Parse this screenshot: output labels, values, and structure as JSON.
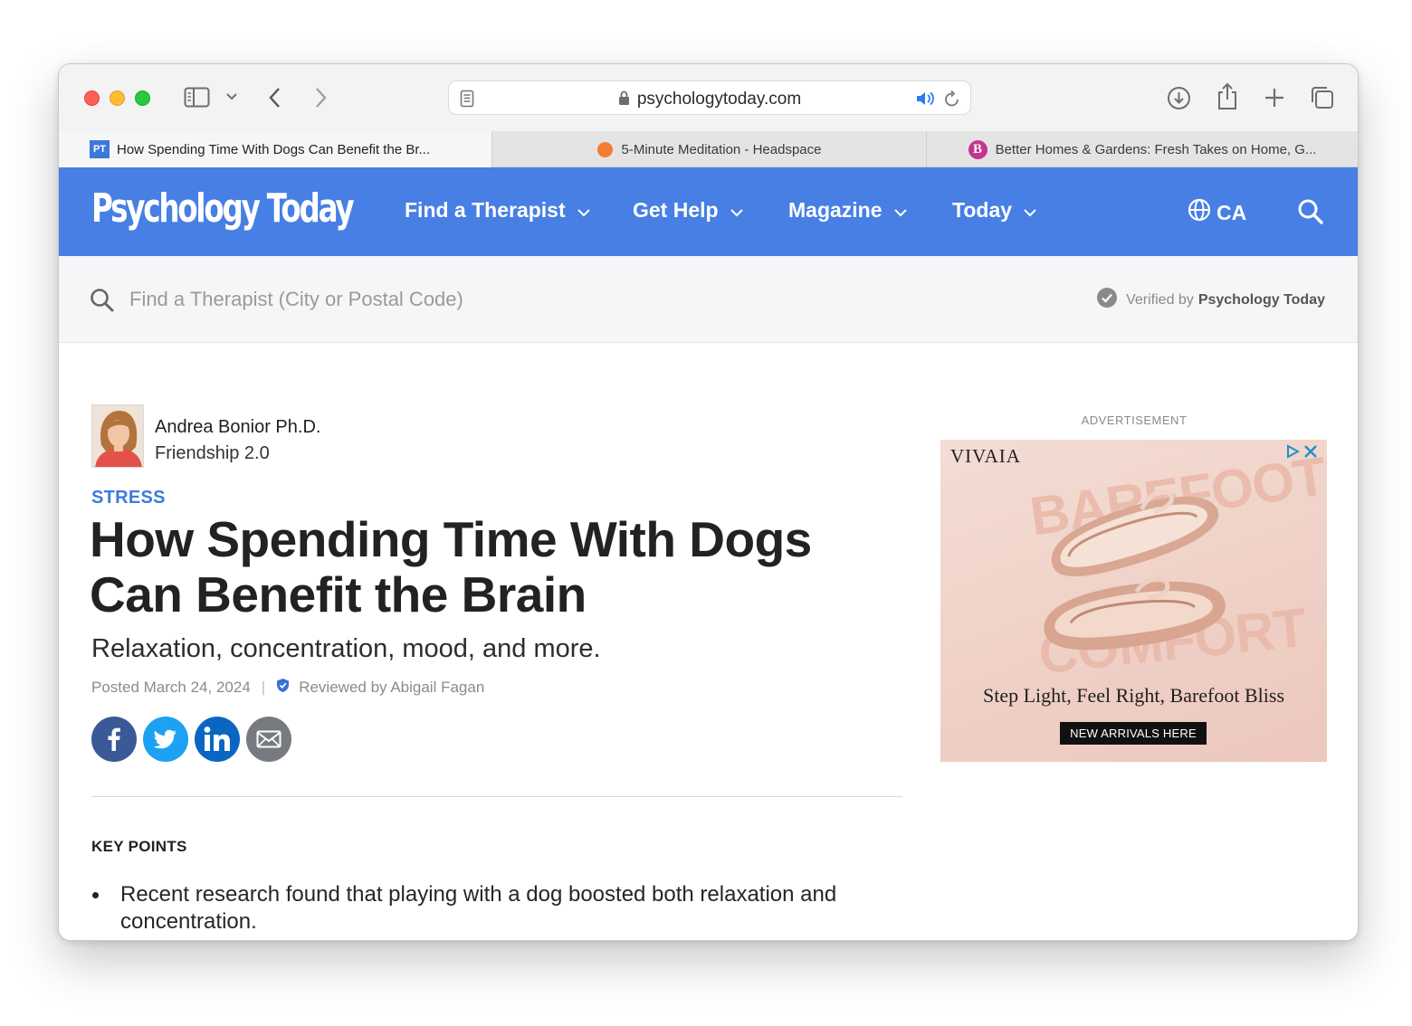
{
  "browser": {
    "url": "psychologytoday.com",
    "tabs": [
      {
        "title": "How Spending Time With Dogs Can Benefit the Br...",
        "favicon": "PT"
      },
      {
        "title": "5-Minute Meditation - Headspace"
      },
      {
        "title": "Better Homes & Gardens: Fresh Takes on Home, G...",
        "favicon": "B"
      }
    ]
  },
  "site": {
    "logo": "Psychology Today",
    "nav": [
      {
        "label": "Find a Therapist"
      },
      {
        "label": "Get Help"
      },
      {
        "label": "Magazine"
      },
      {
        "label": "Today"
      }
    ],
    "region": "CA",
    "search_placeholder": "Find a Therapist (City or Postal Code)",
    "verified_prefix": "Verified by",
    "verified_brand": "Psychology Today",
    "brand_color": "#477fe4"
  },
  "article": {
    "author_name": "Andrea Bonior Ph.D.",
    "author_blog": "Friendship 2.0",
    "category": "STRESS",
    "headline": "How Spending Time With Dogs Can Benefit the Brain",
    "subtitle": "Relaxation, concentration, mood, and more.",
    "posted": "Posted March 24, 2024",
    "separator": "|",
    "reviewed": "Reviewed by Abigail Fagan",
    "key_points_heading": "KEY POINTS",
    "key_points": [
      "Recent research found that playing with a dog boosted both relaxation and concentration."
    ]
  },
  "ad": {
    "label": "ADVERTISEMENT",
    "brand": "VIVAIA",
    "word_top": "BAREFOOT",
    "word_bottom": "COMFORT",
    "tagline": "Step Light, Feel Right, Barefoot Bliss",
    "cta": "NEW ARRIVALS HERE"
  }
}
